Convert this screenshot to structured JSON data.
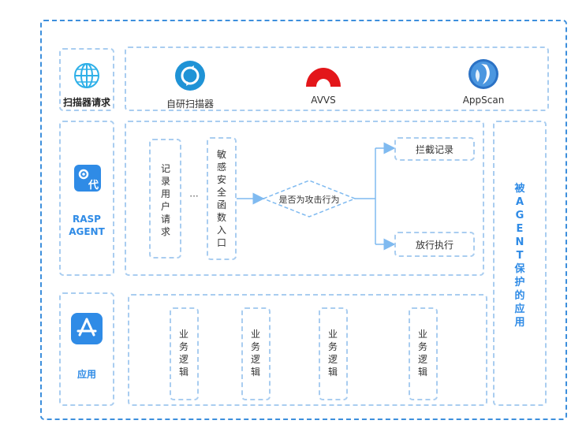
{
  "scanner_row": {
    "label": "扫描器请求",
    "scanners": [
      {
        "name": "自研扫描器",
        "icon": "refresh-circle-icon"
      },
      {
        "name": "AVVS",
        "icon": "avvs-logo-icon"
      },
      {
        "name": "AppScan",
        "icon": "appscan-logo-icon"
      }
    ]
  },
  "rasp_row": {
    "label_line1": "RASP",
    "label_line2": "AGENT",
    "record_box": "记录用户请求",
    "ellipsis": "···",
    "sensitive_box": "敏感安全函数入口",
    "decision": "是否为攻击行为",
    "intercept": "拦截记录",
    "allow": "放行执行"
  },
  "app_row": {
    "label": "应用",
    "logic_boxes": [
      "业务逻辑",
      "业务逻辑",
      "业务逻辑",
      "业务逻辑"
    ]
  },
  "side_label": "被AGENT保护的应用",
  "colors": {
    "accent": "#2f8be6",
    "dashed_border": "#a9cdf0",
    "outer_border": "#3d8fdc"
  }
}
